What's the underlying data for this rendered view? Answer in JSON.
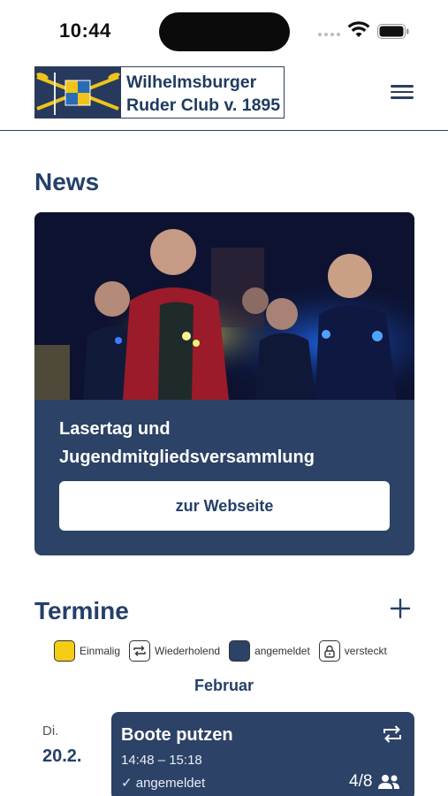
{
  "status_bar": {
    "time": "10:44"
  },
  "header": {
    "logo_line1": "Wilhelmsburger",
    "logo_line2": "Ruder Club v. 1895"
  },
  "news": {
    "heading": "News",
    "article_title": "Lasertag und Jugendmitgliedsversammlung",
    "button_label": "zur Webseite"
  },
  "termine": {
    "heading": "Termine",
    "legend": [
      {
        "label": "Einmalig",
        "color": "#f5cd14",
        "icon": "yellow-square-icon"
      },
      {
        "label": "Wiederholend",
        "color": "#ffffff",
        "icon": "repeat-icon"
      },
      {
        "label": "angemeldet",
        "color": "#2c4266",
        "icon": "navy-square-icon"
      },
      {
        "label": "versteckt",
        "color": "#ffffff",
        "icon": "lock-icon"
      }
    ],
    "month": "Februar",
    "events": [
      {
        "weekday": "Di.",
        "date": "20.2.",
        "title": "Boote putzen",
        "time": "14:48 – 15:18",
        "status": "✓ angemeldet",
        "count": "4/8"
      }
    ]
  },
  "colors": {
    "primary": "#2c4266",
    "heading": "#24406a",
    "accent_yellow": "#f5cd14"
  }
}
